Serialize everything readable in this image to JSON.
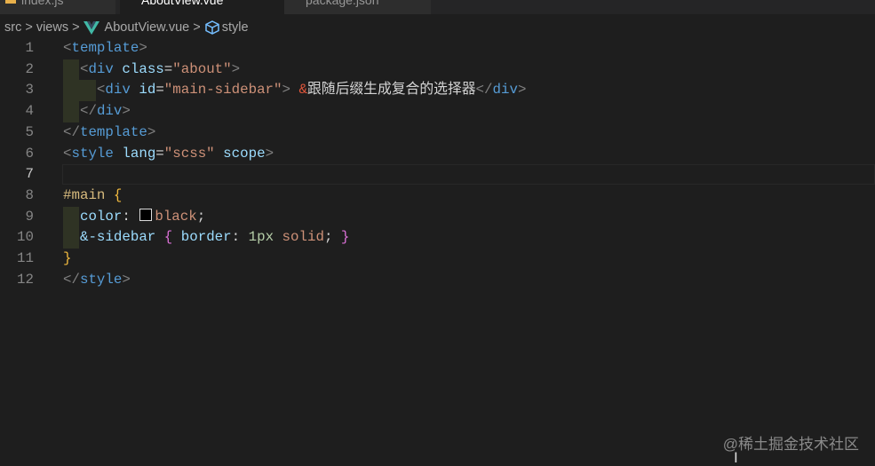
{
  "tabs": [
    {
      "label": "index.js",
      "active": false
    },
    {
      "label": "AboutView.vue",
      "active": true
    },
    {
      "label": "package.json",
      "active": false
    }
  ],
  "breadcrumb": {
    "items": [
      "src",
      "views",
      "AboutView.vue",
      "style"
    ],
    "separator": ">"
  },
  "editor": {
    "current_line": 7,
    "line_numbers": [
      "1",
      "2",
      "3",
      "4",
      "5",
      "6",
      "7",
      "8",
      "9",
      "10",
      "11",
      "12"
    ],
    "lines": [
      [
        [
          "<",
          "p"
        ],
        [
          "template",
          "t"
        ],
        [
          ">",
          "p"
        ]
      ],
      [
        [
          "  ",
          "w"
        ],
        [
          "<",
          "p"
        ],
        [
          "div",
          "t"
        ],
        [
          " ",
          "w"
        ],
        [
          "class",
          "a"
        ],
        [
          "=",
          "w"
        ],
        [
          "\"about\"",
          "s"
        ],
        [
          ">",
          "p"
        ]
      ],
      [
        [
          "    ",
          "w"
        ],
        [
          "<",
          "p"
        ],
        [
          "div",
          "t"
        ],
        [
          " ",
          "w"
        ],
        [
          "id",
          "a"
        ],
        [
          "=",
          "w"
        ],
        [
          "\"main-sidebar\"",
          "s"
        ],
        [
          ">",
          "p"
        ],
        [
          " ",
          "w"
        ],
        [
          "&",
          "amp"
        ],
        [
          "跟随后缀生成复合的选择器",
          "w"
        ],
        [
          "</",
          "p"
        ],
        [
          "div",
          "t"
        ],
        [
          ">",
          "p"
        ]
      ],
      [
        [
          "  ",
          "w"
        ],
        [
          "</",
          "p"
        ],
        [
          "div",
          "t"
        ],
        [
          ">",
          "p"
        ]
      ],
      [
        [
          "</",
          "p"
        ],
        [
          "template",
          "t"
        ],
        [
          ">",
          "p"
        ]
      ],
      [
        [
          "<",
          "p"
        ],
        [
          "style",
          "t"
        ],
        [
          " ",
          "w"
        ],
        [
          "lang",
          "a"
        ],
        [
          "=",
          "w"
        ],
        [
          "\"scss\"",
          "s"
        ],
        [
          " ",
          "w"
        ],
        [
          "scope",
          "a"
        ],
        [
          ">",
          "p"
        ]
      ],
      [],
      [
        [
          "#main",
          "sel"
        ],
        [
          " ",
          "w"
        ],
        [
          "{",
          "b"
        ]
      ],
      [
        [
          "  ",
          "w"
        ],
        [
          "color",
          "pr"
        ],
        [
          ": ",
          "w"
        ],
        [
          "",
          "sw"
        ],
        [
          "black",
          "v"
        ],
        [
          ";",
          "w"
        ]
      ],
      [
        [
          "  ",
          "w"
        ],
        [
          "&-sidebar",
          "a"
        ],
        [
          " ",
          "w"
        ],
        [
          "{",
          "b2"
        ],
        [
          " ",
          "w"
        ],
        [
          "border",
          "pr"
        ],
        [
          ": ",
          "w"
        ],
        [
          "1px",
          "n"
        ],
        [
          " ",
          "w"
        ],
        [
          "solid",
          "v"
        ],
        [
          ";",
          "w"
        ],
        [
          " ",
          "w"
        ],
        [
          "}",
          "b2"
        ]
      ],
      [
        [
          "}",
          "b"
        ]
      ],
      [
        [
          "</",
          "p"
        ],
        [
          "style",
          "t"
        ],
        [
          ">",
          "p"
        ]
      ]
    ]
  },
  "watermark": "@稀土掘金技术社区"
}
